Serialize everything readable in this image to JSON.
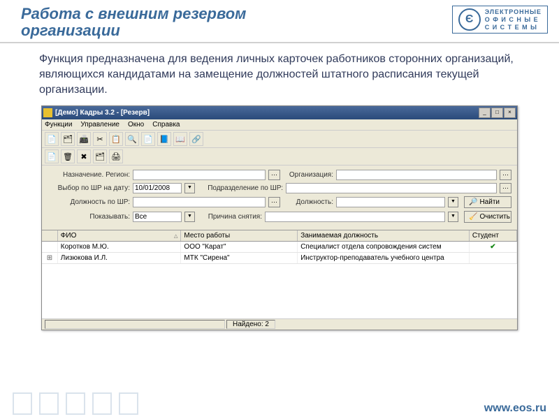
{
  "slide": {
    "title_line1": "Работа с внешним резервом",
    "title_line2": "организации",
    "body": "Функция предназначена для ведения личных карточек работников сторонних организаций, являющихся кандидатами на замещение должностей штатного расписания текущей организации."
  },
  "logo": {
    "glyph": "Є",
    "line1": "ЭЛЕКТРОННЫЕ",
    "line2": "О Ф И С Н Ы Е",
    "line3": "С И С Т Е М Ы"
  },
  "app": {
    "title": "[Демо] Кадры 3.2 - [Резерв]",
    "menu": {
      "functions": "Функции",
      "manage": "Управление",
      "window": "Окно",
      "help": "Справка"
    },
    "filters": {
      "region_label": "Назначение. Регион:",
      "org_label": "Организация:",
      "date_label": "Выбор по ШР на дату:",
      "date_value": "10/01/2008",
      "dept_label": "Подразделение по ШР:",
      "pos_shr_label": "Должность по ШР:",
      "pos_label": "Должность:",
      "show_label": "Показывать:",
      "show_value": "Все",
      "reason_label": "Причина снятия:",
      "find_btn": "Найти",
      "clear_btn": "Очистить"
    },
    "grid": {
      "headers": {
        "fio": "ФИО",
        "work": "Место работы",
        "pos": "Занимаемая должность",
        "stud": "Студент"
      },
      "rows": [
        {
          "fio": "Коротков М.Ю.",
          "work": "ООО \"Карат\"",
          "pos": "Специалист отдела сопровождения систем",
          "stud": true
        },
        {
          "fio": "Лизюкова И.Л.",
          "work": "МТК \"Сирена\"",
          "pos": "Инструктор-преподаватель учебного центра",
          "stud": false
        }
      ]
    },
    "status": {
      "found_label": "Найдено: 2"
    }
  },
  "footer": {
    "url": "www.eos.ru"
  },
  "icons": {
    "tb": [
      "📄",
      "🗂",
      "📠",
      "✂",
      "📋",
      "🔍",
      "📄",
      "📘",
      "📖",
      "🔗"
    ],
    "tb2": [
      "📄",
      "🗑",
      "✖",
      "🗂",
      "🖨"
    ],
    "binoc": "🔎",
    "broom": "🧹"
  }
}
